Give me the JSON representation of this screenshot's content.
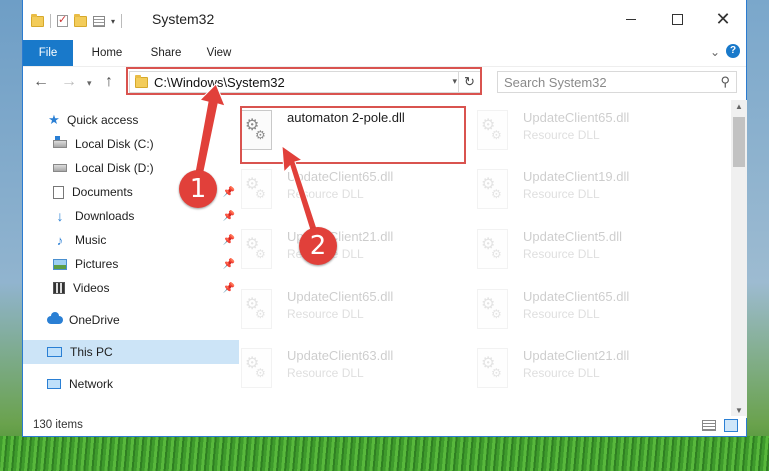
{
  "window": {
    "title": "System32"
  },
  "ribbon": {
    "tabs": [
      "File",
      "Home",
      "Share",
      "View"
    ],
    "help_label": "?"
  },
  "nav": {
    "address": "C:\\Windows\\System32",
    "search_placeholder": "Search System32"
  },
  "sidebar": {
    "items": [
      {
        "label": "Quick access",
        "icon": "star-icon",
        "pinned": false
      },
      {
        "label": "Local Disk (C:)",
        "icon": "drive-icon",
        "pinned": false
      },
      {
        "label": "Local Disk (D:)",
        "icon": "drive-icon",
        "pinned": false
      },
      {
        "label": "Documents",
        "icon": "documents-icon",
        "pinned": true
      },
      {
        "label": "Downloads",
        "icon": "download-icon",
        "pinned": true
      },
      {
        "label": "Music",
        "icon": "music-icon",
        "pinned": true
      },
      {
        "label": "Pictures",
        "icon": "pictures-icon",
        "pinned": true
      },
      {
        "label": "Videos",
        "icon": "videos-icon",
        "pinned": true
      },
      {
        "label": "OneDrive",
        "icon": "cloud-icon",
        "pinned": false
      },
      {
        "label": "This PC",
        "icon": "pc-icon",
        "pinned": false,
        "selected": true
      },
      {
        "label": "Network",
        "icon": "network-icon",
        "pinned": false
      }
    ]
  },
  "files": {
    "highlighted": {
      "name": "automaton 2-pole.dll",
      "type": ""
    },
    "items": [
      {
        "name": "UpdateClient65.dll",
        "type": "Resource DLL"
      },
      {
        "name": "UpdateClient65.dll",
        "type": "Resource DLL"
      },
      {
        "name": "UpdateClient19.dll",
        "type": "Resource DLL"
      },
      {
        "name": "UpdateClient21.dll",
        "type": "Resource DLL"
      },
      {
        "name": "UpdateClient5.dll",
        "type": "Resource DLL"
      },
      {
        "name": "UpdateClient65.dll",
        "type": "Resource DLL"
      },
      {
        "name": "UpdateClient65.dll",
        "type": "Resource DLL"
      },
      {
        "name": "UpdateClient63.dll",
        "type": "Resource DLL"
      },
      {
        "name": "UpdateClient21.dll",
        "type": "Resource DLL"
      }
    ]
  },
  "status": {
    "count": "130 items"
  },
  "callouts": {
    "one": "1",
    "two": "2",
    "color": "#e1403a"
  }
}
